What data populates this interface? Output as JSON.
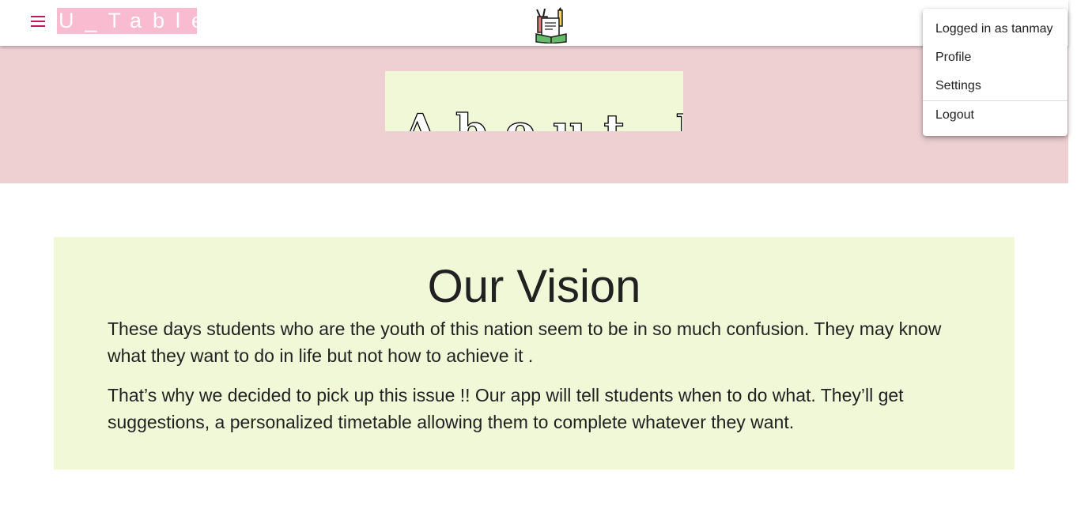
{
  "app": {
    "brand": "U_Table",
    "colors": {
      "accent": "#c2185b",
      "brand_bg": "#f8bbd0",
      "hero_bg": "#eed0d3",
      "card_bg": "#f1f8d8"
    },
    "icons": {
      "menu": "hamburger-menu-icon",
      "logo": "books-and-pencils-logo"
    }
  },
  "hero": {
    "title": "About Us"
  },
  "vision": {
    "title": "Our Vision",
    "paragraphs": [
      "These days students who are the youth of this nation seem to be in so much confusion. They may know what they want to do in life but not how to achieve it .",
      "That’s why we decided to pick up this issue !! Our app will tell students when to do what. They’ll get suggestions, a personalized timetable allowing them to complete whatever they want."
    ]
  },
  "user_menu": {
    "logged_in_label": "Logged in as tanmay",
    "items": [
      {
        "label": "Profile"
      },
      {
        "label": "Settings"
      },
      {
        "label": "Logout"
      }
    ]
  }
}
